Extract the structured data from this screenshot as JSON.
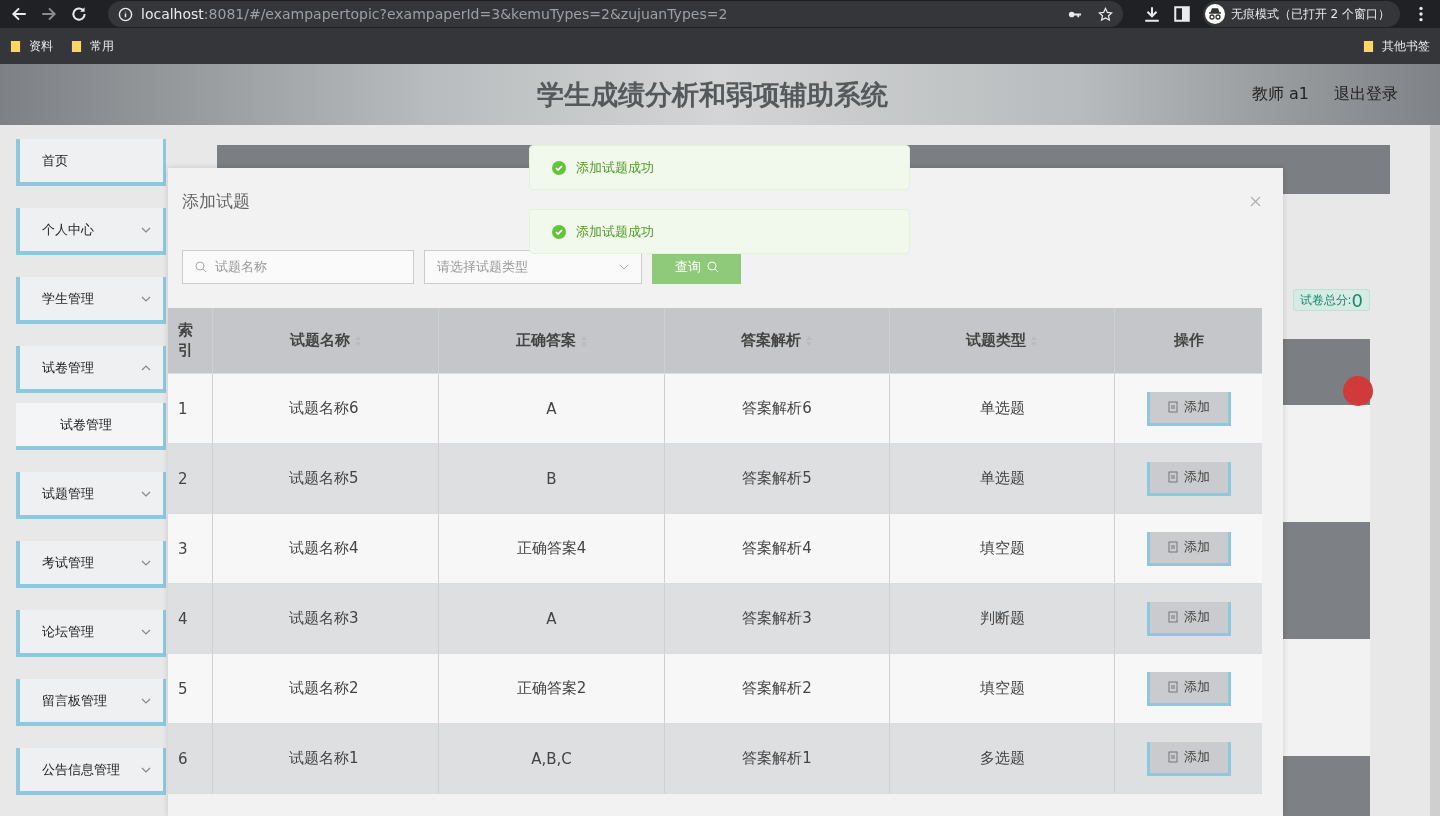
{
  "browser": {
    "url_host": "localhost",
    "url_rest": ":8081/#/exampapertopic?exampaperId=3&kemuTypes=2&zujuanTypes=2",
    "incognito": "无痕模式（已打开 2 个窗口）",
    "bookmarks": [
      "资料",
      "常用"
    ],
    "other_bookmarks": "其他书签"
  },
  "header": {
    "title": "学生成绩分析和弱项辅助系统",
    "user": "教师 a1",
    "logout": "退出登录"
  },
  "sidebar": {
    "items": [
      {
        "label": "首页"
      },
      {
        "label": "个人中心",
        "expanded": false
      },
      {
        "label": "学生管理",
        "expanded": false
      },
      {
        "label": "试卷管理",
        "expanded": true,
        "children": [
          {
            "label": "试卷管理"
          }
        ]
      },
      {
        "label": "试题管理",
        "expanded": false
      },
      {
        "label": "考试管理",
        "expanded": false
      },
      {
        "label": "论坛管理",
        "expanded": false
      },
      {
        "label": "留言板管理",
        "expanded": false
      },
      {
        "label": "公告信息管理",
        "expanded": false
      }
    ]
  },
  "total": {
    "label": "试卷总分:",
    "value": "0"
  },
  "dialog": {
    "title": "添加试题",
    "search_placeholder": "试题名称",
    "select_placeholder": "请选择试题类型",
    "query": "查询",
    "columns": [
      "索引",
      "试题名称",
      "正确答案",
      "答案解析",
      "试题类型",
      "操作"
    ],
    "rows": [
      {
        "index": "1",
        "name": "试题名称6",
        "answer": "A",
        "analysis": "答案解析6",
        "type": "单选题",
        "action": "添加"
      },
      {
        "index": "2",
        "name": "试题名称5",
        "answer": "B",
        "analysis": "答案解析5",
        "type": "单选题",
        "action": "添加"
      },
      {
        "index": "3",
        "name": "试题名称4",
        "answer": "正确答案4",
        "analysis": "答案解析4",
        "type": "填空题",
        "action": "添加"
      },
      {
        "index": "4",
        "name": "试题名称3",
        "answer": "A",
        "analysis": "答案解析3",
        "type": "判断题",
        "action": "添加"
      },
      {
        "index": "5",
        "name": "试题名称2",
        "answer": "正确答案2",
        "analysis": "答案解析2",
        "type": "填空题",
        "action": "添加"
      },
      {
        "index": "6",
        "name": "试题名称1",
        "answer": "A,B,C",
        "analysis": "答案解析1",
        "type": "多选题",
        "action": "添加"
      }
    ]
  },
  "toasts": [
    "添加试题成功",
    "添加试题成功"
  ]
}
